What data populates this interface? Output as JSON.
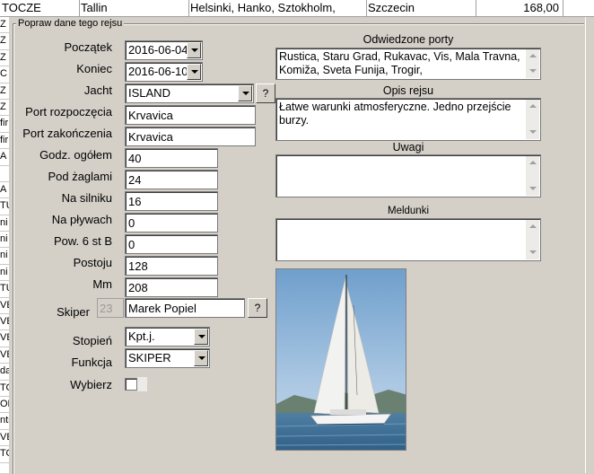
{
  "background_table": {
    "top_row": [
      "TOCZE",
      "Tallin",
      "Helsinki, Hanko, Sztokholm,",
      "Szczecin",
      "168,00"
    ],
    "left_column": [
      "Z",
      "Z",
      "Z",
      "C",
      "Z",
      "Z",
      "fir",
      "fir",
      "A",
      "",
      "A",
      "TU",
      "ni",
      "ni",
      "ni",
      "ni",
      "TU",
      "VE",
      "VE",
      "VE",
      "VE",
      "da",
      "TO",
      "ON",
      "ntr",
      "VE",
      "TO"
    ]
  },
  "group_title": "Popraw dane tego rejsu",
  "form": {
    "start_label": "Początek",
    "start_value": "2016-06-04",
    "end_label": "Koniec",
    "end_value": "2016-06-10",
    "yacht_label": "Jacht",
    "yacht_value": "ISLAND",
    "question_mark": "?",
    "start_port_label": "Port rozpoczęcia",
    "start_port_value": "Krvavica",
    "end_port_label": "Port zakończenia",
    "end_port_value": "Krvavica",
    "hours_total_label": "Godz. ogółem",
    "hours_total_value": "40",
    "under_sail_label": "Pod żaglami",
    "under_sail_value": "24",
    "engine_label": "Na silniku",
    "engine_value": "16",
    "tidal_label": "Na pływach",
    "tidal_value": "0",
    "wind6_label": "Pow. 6 st B",
    "wind6_value": "0",
    "harbour_label": "Postoju",
    "harbour_value": "128",
    "nm_label": "Mm",
    "nm_value": "208",
    "skipper_label": "Skiper",
    "skipper_id": "23",
    "skipper_name": "Marek Popiel",
    "rank_label": "Stopień",
    "rank_value": "Kpt.j.",
    "function_label": "Funkcja",
    "function_value": "SKIPER",
    "select_label": "Wybierz"
  },
  "memos": {
    "ports_label": "Odwiedzone porty",
    "ports_text": "Rustica, Staru Grad, Rukavac, Vis, Mala Travna, Komiža, Sveta Funija, Trogir,",
    "description_label": "Opis rejsu",
    "description_text": "Łatwe warunki atmosferyczne. Jedno przejście burzy.",
    "notes_label": "Uwagi",
    "notes_text": "",
    "reports_label": "Meldunki",
    "reports_text": ""
  },
  "icons": {
    "dropdown": "chevron-down-icon",
    "scroll_up": "arrow-up-icon",
    "scroll_down": "arrow-down-icon",
    "photo": "sailboat-photo"
  }
}
